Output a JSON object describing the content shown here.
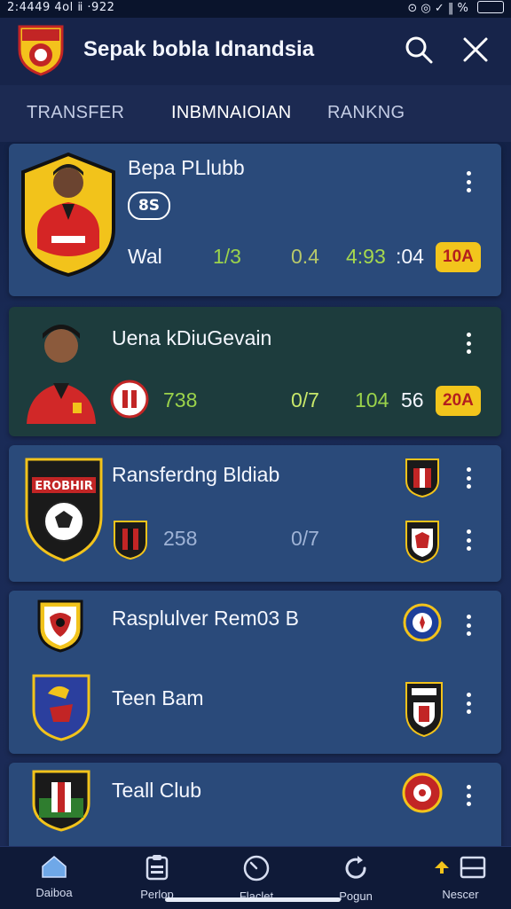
{
  "status_bar": {
    "time": "2:4449 4ol ⅱ ·922",
    "indicators": "⊙ ◎ ✓ ‖ %"
  },
  "header": {
    "title": "Sepak bobla Idnandsia"
  },
  "tabs": [
    {
      "label": "TRANSFER",
      "active": false
    },
    {
      "label": "INBMNAIOIAN",
      "active": true
    },
    {
      "label": "RANKNG",
      "active": false
    }
  ],
  "cards": [
    {
      "name": "Bepa PLlubb",
      "pill": "8S",
      "label": "Wal",
      "stats": [
        "1/3",
        "0.4",
        "4:93",
        ":04"
      ],
      "badge": "10A"
    },
    {
      "name": "Uena kDiuGevain",
      "stats": [
        "738",
        "0/7",
        "104",
        "56"
      ],
      "badge": "20A"
    },
    {
      "name": "Ransferdng Bldiab",
      "crest_text": "EROBHIR",
      "stats": [
        "258",
        "0/7"
      ]
    },
    {
      "rows": [
        {
          "name": "Rasplulver Rem03 B"
        },
        {
          "name": "Teen Bam"
        }
      ]
    },
    {
      "name": "Teall Club"
    }
  ],
  "bottom_nav": [
    {
      "label": "Daiboa",
      "icon": "home-icon"
    },
    {
      "label": "Perlop",
      "icon": "clipboard-icon"
    },
    {
      "label": "Flaclet",
      "icon": "stopwatch-icon"
    },
    {
      "label": "Pogun",
      "icon": "refresh-icon"
    },
    {
      "label": "Nescer",
      "icon": "inbox-icon"
    }
  ],
  "colors": {
    "badge": "#f2c51c",
    "accent_green": "#9bd34b",
    "card": "#2a4a7a",
    "card_dark": "#1d3c3d"
  }
}
